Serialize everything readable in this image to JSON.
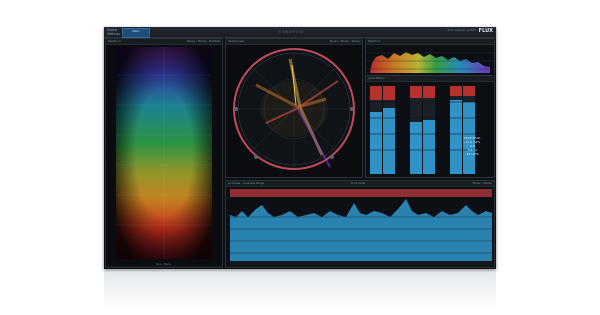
{
  "app": {
    "menu": [
      "Global",
      "Settings"
    ],
    "active_tab": "Main",
    "center_title": "SYNOPTIK",
    "brand": "FLUX",
    "brand_sub": "Pure Analyzer System"
  },
  "panels": {
    "spectrogram": {
      "title": "Spectrum",
      "header_right": "Stereo - Stereo - Mid/Side",
      "footer": "Mono / Stereo"
    },
    "vectorscope": {
      "title": "Vectorscope",
      "header_right": "Stereo - Stereo - Stereo"
    },
    "spectrum": {
      "title": "Spectrum"
    },
    "meters": {
      "title": "Level Meters",
      "readout": [
        "TRUE PEAK",
        "-12.0 LUFS",
        "-4.8",
        "-8.4 LU",
        "-16 LUFS"
      ]
    },
    "timeline": {
      "header_left": "Loudness - Loudness Range",
      "header_center": "Time Scale",
      "header_right": "Stereo - Stereo"
    }
  },
  "colors": {
    "meter_fill": "#2f93c8",
    "meter_peak": "#b6312c",
    "timeline_fill": "#2d8fc2",
    "timeline_top": "#a7353b",
    "scope_ring": "#c24a5a"
  },
  "icons": {
    "window_tools": "toolbar-icons",
    "scope_handles": "circle-handle-icon"
  }
}
